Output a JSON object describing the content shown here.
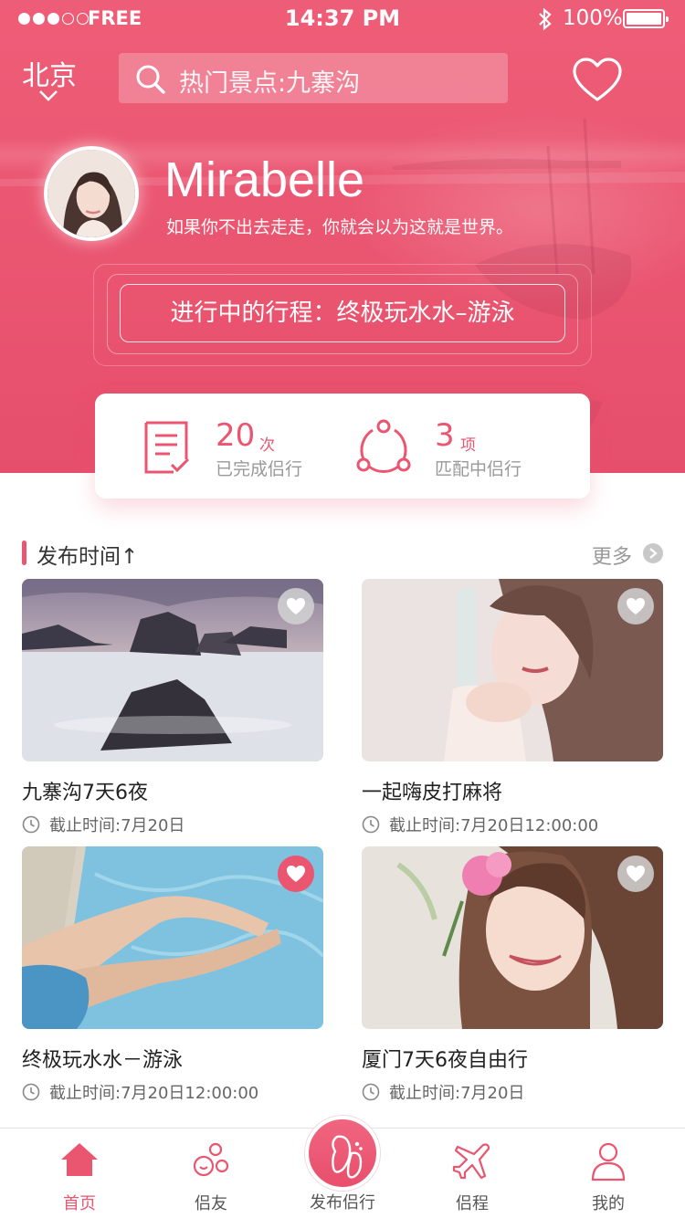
{
  "status_bar": {
    "carrier": "FREE",
    "time": "14:37 PM",
    "battery": "100%"
  },
  "header": {
    "city": "北京",
    "search_placeholder": "热门景点:九寨沟"
  },
  "profile": {
    "name": "Mirabelle",
    "motto": "如果你不出去走走，你就会以为这就是世界。",
    "current_trip": "进行中的行程：终极玩水水–游泳"
  },
  "stats": [
    {
      "value": "20",
      "unit": "次",
      "label": "已完成侣行",
      "icon": "checklist-icon"
    },
    {
      "value": "3",
      "unit": "项",
      "label": "匹配中侣行",
      "icon": "share-network-icon"
    }
  ],
  "section": {
    "title": "发布时间↑",
    "more": "更多"
  },
  "cards": [
    {
      "title": "九寨沟7天6夜",
      "deadline": "截止时间:7月20日",
      "favorited": false,
      "image": "seascape-rocks-photo"
    },
    {
      "title": "一起嗨皮打麻将",
      "deadline": "截止时间:7月20日12:00:00",
      "favorited": false,
      "image": "woman-with-bottle-photo"
    },
    {
      "title": "终极玩水水－游泳",
      "deadline": "截止时间:7月20日12:00:00",
      "favorited": true,
      "image": "legs-in-pool-photo"
    },
    {
      "title": "厦门7天6夜自由行",
      "deadline": "截止时间:7月20日",
      "favorited": false,
      "image": "smiling-woman-flower-photo"
    }
  ],
  "tabs": [
    {
      "label": "首页",
      "icon": "home-icon",
      "active": true
    },
    {
      "label": "侣友",
      "icon": "bubbles-icon",
      "active": false
    },
    {
      "label": "发布侣行",
      "icon": "footprints-icon",
      "active": false
    },
    {
      "label": "侣程",
      "icon": "airplane-icon",
      "active": false
    },
    {
      "label": "我的",
      "icon": "person-icon",
      "active": false
    }
  ],
  "colors": {
    "accent": "#ea5570",
    "hero": "#ee5d77",
    "text_primary": "#222222",
    "text_secondary": "#999999"
  }
}
